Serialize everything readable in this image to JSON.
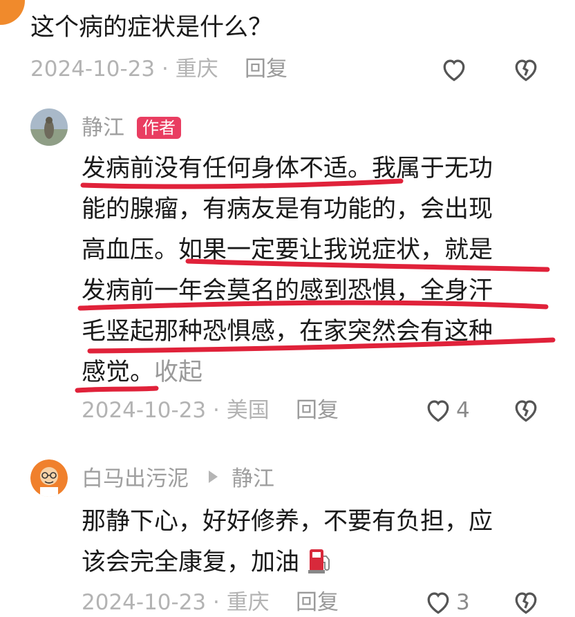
{
  "question": {
    "text": "这个病的症状是什么？",
    "date": "2024-10-23",
    "location": "重庆",
    "reply_label": "回复"
  },
  "author_reply": {
    "name": "静江",
    "badge": "作者",
    "lines": [
      "发病前没有任何身体不适。我属于无功",
      "能的腺瘤，有病友是有功能的，会出现",
      "高血压。如果一定要让我说症状，就是",
      "发病前一年会莫名的感到恐惧，全身汗",
      "毛竖起那种恐惧感，在家突然会有这种",
      "感觉。"
    ],
    "collapse_label": "收起",
    "date": "2024-10-23",
    "location": "美国",
    "reply_label": "回复",
    "like_count": "4"
  },
  "sub_reply": {
    "name": "白马出污泥",
    "target": "静江",
    "lines": [
      "那静下心，好好修养，不要有负担，应",
      "该会完全康复，加油"
    ],
    "date": "2024-10-23",
    "location": "重庆",
    "reply_label": "回复",
    "like_count": "3"
  },
  "colors": {
    "badge": "#e93d61",
    "underline": "#e0223a",
    "meta": "#b3b3b3"
  },
  "icons": {
    "like": "heart-outline-icon",
    "dislike": "broken-heart-icon",
    "fuel": "fuel-pump-icon"
  }
}
